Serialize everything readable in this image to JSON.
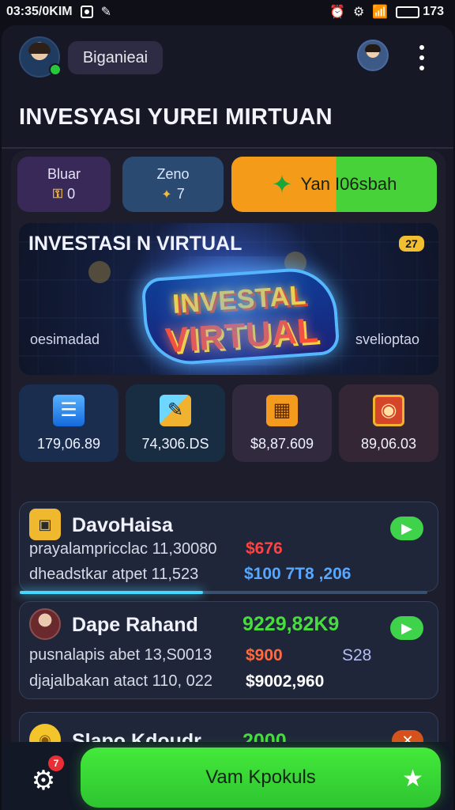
{
  "status_bar": {
    "time": "03:35/0KIM",
    "battery_text": "173"
  },
  "header": {
    "user_name": "Biganieai",
    "title": "INVESYASI YUREI MIRTUAN"
  },
  "chips": {
    "one_title": "Bluar",
    "one_value": "0",
    "two_title": "Zeno",
    "two_value": "7",
    "cta_label": "Yan I06sbah"
  },
  "banner": {
    "title": "INVESTASI N VIRTUAL",
    "badge": "27",
    "logo_top": "INVESTAL",
    "logo_bottom": "VIRTUAL",
    "left_caption": "oesimadad",
    "right_caption": "svelioptao"
  },
  "stats": [
    {
      "value": "179,06.89"
    },
    {
      "value": "74,306.DS"
    },
    {
      "value": "$8,87.609"
    },
    {
      "value": "89,06.03"
    }
  ],
  "rows": [
    {
      "title": "DavoHaisa",
      "line1": "prayalampricclac 11,30080",
      "line2": "dheadstkar atpet 11,523",
      "value1": "$676",
      "value2": "$100 7T8 ,206",
      "progress_percent": 45
    },
    {
      "title": "Dape Rahand",
      "metric": "9229,82K9",
      "line1": "pusnalapis abet 13,S0013",
      "line2": "djajalbakan atact 110, 022",
      "value1": "$900",
      "value2": "$9002,960",
      "value3": "S28"
    },
    {
      "title": "Slapo Kdoudr",
      "metric": "2000"
    }
  ],
  "bottom_nav": {
    "badge": "7",
    "primary_label": "Vam Kpokuls"
  },
  "colors": {
    "green": "#43ea3a",
    "orange": "#f49b19",
    "accent_blue": "#45d7ff",
    "background": "#171826"
  }
}
